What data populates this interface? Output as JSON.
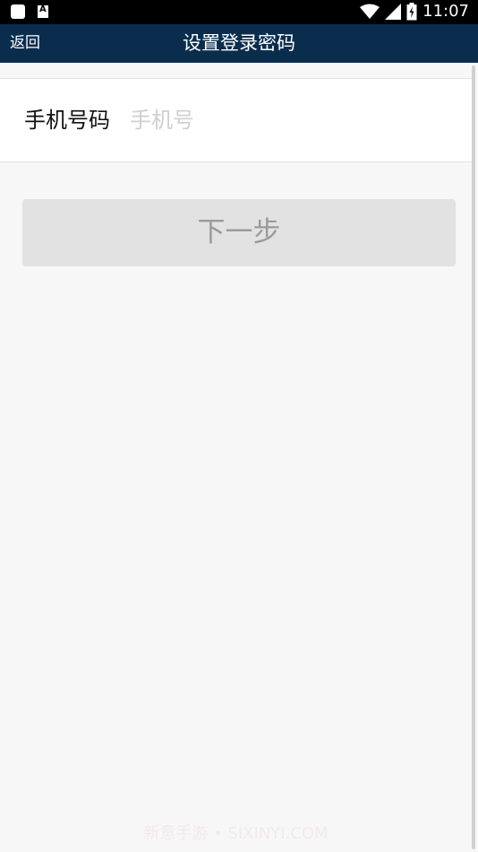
{
  "status_bar": {
    "time": "11:07",
    "icons": [
      "notification-square-icon",
      "font-a-icon",
      "wifi-icon",
      "cell-signal-icon",
      "battery-icon"
    ]
  },
  "header": {
    "back_label": "返回",
    "title": "设置登录密码"
  },
  "form": {
    "phone_label": "手机号码",
    "phone_placeholder": "手机号",
    "phone_value": ""
  },
  "actions": {
    "next_label": "下一步"
  },
  "watermark": "新意手游 • SIXINYI.COM",
  "colors": {
    "header_bg": "#0a2d4d",
    "button_bg": "#e2e2e2",
    "button_text": "#9a9a9a",
    "page_bg": "#f7f7f7"
  }
}
